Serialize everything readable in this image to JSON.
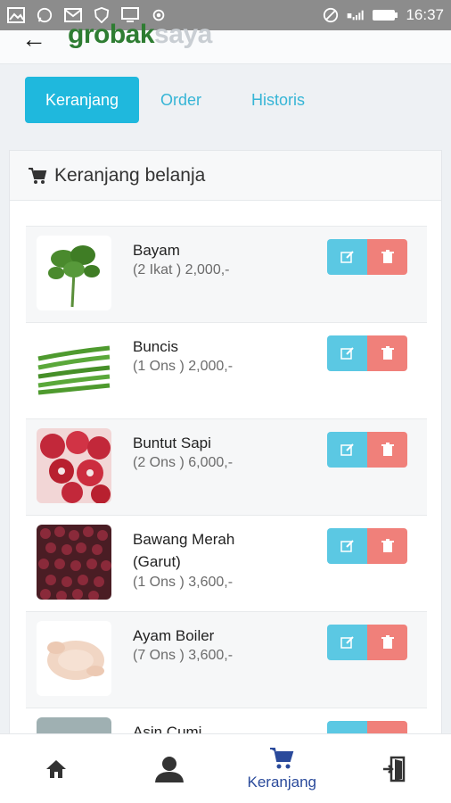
{
  "status_bar": {
    "time": "16:37"
  },
  "header": {
    "brand_part1": "grobak",
    "brand_part2": "saya"
  },
  "tabs": [
    {
      "label": "Keranjang"
    },
    {
      "label": "Order"
    },
    {
      "label": "Historis"
    }
  ],
  "card": {
    "title": "Keranjang belanja"
  },
  "items": [
    {
      "name": "Bayam",
      "detail": "(2 Ikat ) 2,000,-"
    },
    {
      "name": "Buncis",
      "detail": "(1 Ons ) 2,000,-"
    },
    {
      "name": "Buntut Sapi",
      "detail": "(2 Ons ) 6,000,-"
    },
    {
      "name": "Bawang Merah (Garut)",
      "detail": "(1 Ons ) 3,600,-"
    },
    {
      "name": "Ayam Boiler",
      "detail": "(7 Ons ) 3,600,-"
    },
    {
      "name": "Asin Cumi",
      "detail": ""
    }
  ],
  "bottom_nav": {
    "cart_label": "Keranjang"
  },
  "colors": {
    "accent": "#1fb8dd",
    "edit": "#5bc8e3",
    "delete": "#f0807a",
    "nav_active": "#2a4a9b"
  }
}
